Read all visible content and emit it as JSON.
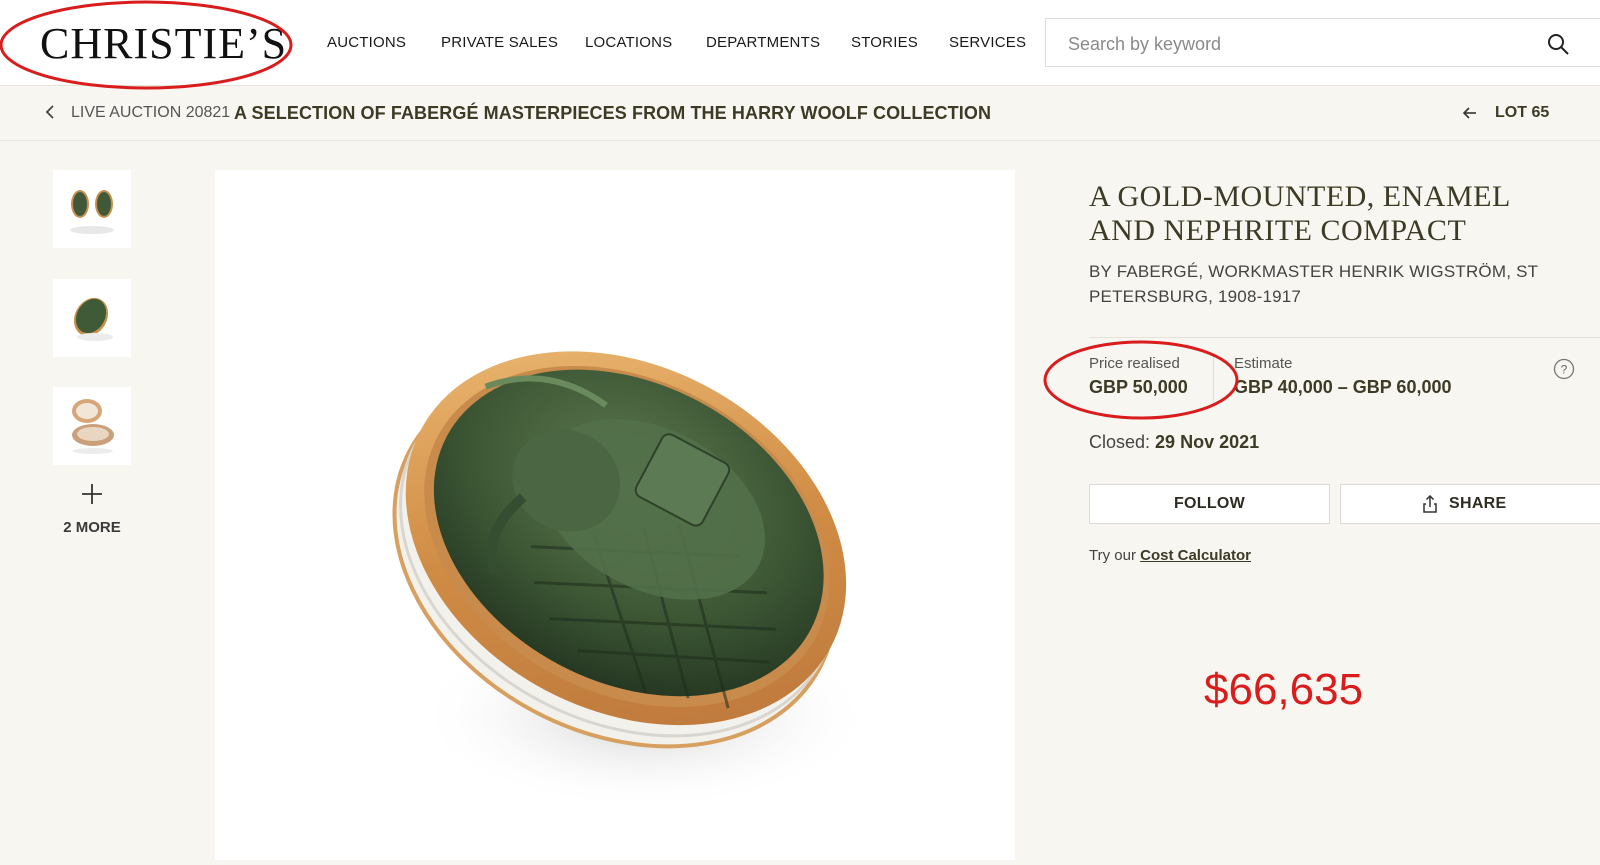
{
  "header": {
    "logo": "CHRISTIE’S",
    "nav": [
      {
        "label": "AUCTIONS"
      },
      {
        "label": "PRIVATE SALES"
      },
      {
        "label": "LOCATIONS"
      },
      {
        "label": "DEPARTMENTS"
      },
      {
        "label": "STORIES"
      },
      {
        "label": "SERVICES"
      }
    ],
    "search": {
      "placeholder": "Search by keyword",
      "value": ""
    }
  },
  "breadcrumb": {
    "prefix": "LIVE AUCTION 20821",
    "title": "A SELECTION OF FABERGÉ MASTERPIECES FROM THE HARRY WOOLF COLLECTION",
    "lot": "LOT 65"
  },
  "gallery": {
    "more_label": "2 MORE"
  },
  "lot": {
    "title": "A GOLD-MOUNTED, ENAMEL AND NEPHRITE COMPACT",
    "subtitle": "BY FABERGÉ, WORKMASTER HENRIK WIGSTRÖM, ST PETERSBURG, 1908-1917",
    "price_label": "Price realised",
    "price_value": "GBP 50,000",
    "estimate_label": "Estimate",
    "estimate_value": "GBP 40,000 – GBP 60,000",
    "closed_label": "Closed:",
    "closed_date": "29 Nov 2021",
    "follow_label": "FOLLOW",
    "share_label": "SHARE",
    "calc_prefix": "Try our",
    "calc_link": "Cost Calculator"
  },
  "annotation": {
    "usd_value": "$66,635",
    "color": "#d91c1c"
  },
  "colors": {
    "accent": "#3d3a26",
    "page_bg": "#f7f6f1",
    "nephrite": "#3f5a36",
    "gold": "#d9a05a"
  }
}
